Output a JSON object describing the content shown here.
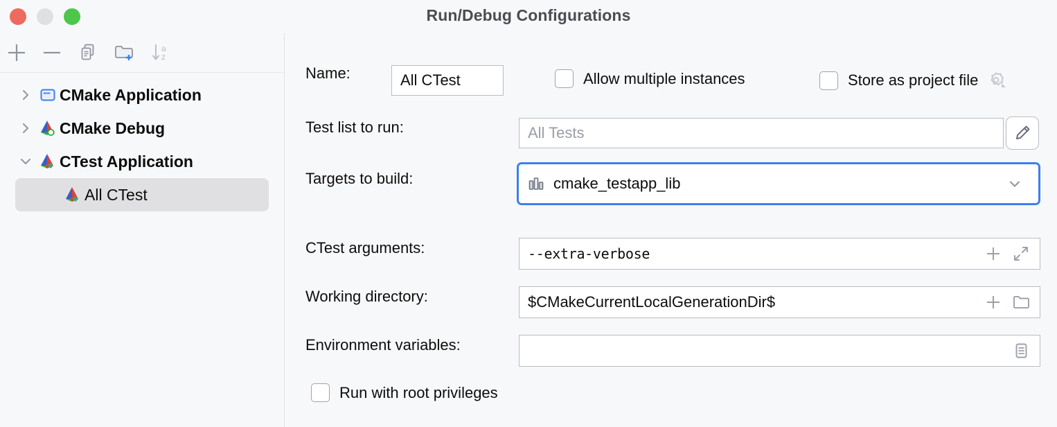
{
  "window": {
    "title": "Run/Debug Configurations",
    "traffic_lights": [
      "close-button",
      "minimize-button",
      "maximize-button"
    ]
  },
  "sidebar": {
    "toolbar": [
      {
        "name": "add-configuration-button",
        "icon": "plus-icon"
      },
      {
        "name": "remove-configuration-button",
        "icon": "minus-icon"
      },
      {
        "name": "copy-configuration-button",
        "icon": "copy-icon"
      },
      {
        "name": "new-folder-button",
        "icon": "folder-add-icon"
      },
      {
        "name": "sort-alphabetically-button",
        "icon": "sort-az-icon"
      }
    ],
    "tree": [
      {
        "label": "CMake Application",
        "icon": "cmake-application-icon",
        "expander": "chevron-right-icon",
        "level": 0,
        "selected": false
      },
      {
        "label": "CMake Debug",
        "icon": "cmake-debug-icon",
        "expander": "chevron-right-icon",
        "level": 0,
        "selected": false
      },
      {
        "label": "CTest Application",
        "icon": "ctest-application-icon",
        "expander": "chevron-down-icon",
        "level": 0,
        "selected": false
      },
      {
        "label": "All CTest",
        "icon": "ctest-application-icon",
        "expander": "",
        "level": 1,
        "selected": true
      }
    ]
  },
  "form": {
    "name": {
      "label": "Name:",
      "value": "All CTest"
    },
    "allow_multiple_instances": {
      "label": "Allow multiple instances",
      "checked": false
    },
    "store_as_project_file": {
      "label": "Store as project file",
      "checked": false,
      "gear_icon": "gear-icon"
    },
    "test_list": {
      "label": "Test list to run:",
      "value": "",
      "placeholder": "All Tests",
      "edit_icon": "pencil-icon"
    },
    "targets_to_build": {
      "label": "Targets to build:",
      "value": "cmake_testapp_lib",
      "item_icon": "library-icon",
      "chevron": "chevron-down-icon",
      "focused": true
    },
    "ctest_arguments": {
      "label": "CTest arguments:",
      "value": "--extra-verbose",
      "icons": [
        "plus-icon",
        "expand-icon"
      ]
    },
    "working_directory": {
      "label": "Working directory:",
      "value": "$CMakeCurrentLocalGenerationDir$",
      "icons": [
        "plus-icon",
        "folder-icon"
      ]
    },
    "environment_variables": {
      "label": "Environment variables:",
      "value": "",
      "icons": [
        "list-document-icon"
      ]
    },
    "run_with_root_privileges": {
      "label": "Run with root privileges",
      "checked": false
    }
  },
  "colors": {
    "background": "#f7f8fa",
    "focus_ring": "#3b7ff0",
    "selected_row": "#e0e0e2",
    "field_border": "#b9bcc4",
    "placeholder_text": "#9a9da5",
    "title_text": "#4a4d52"
  }
}
